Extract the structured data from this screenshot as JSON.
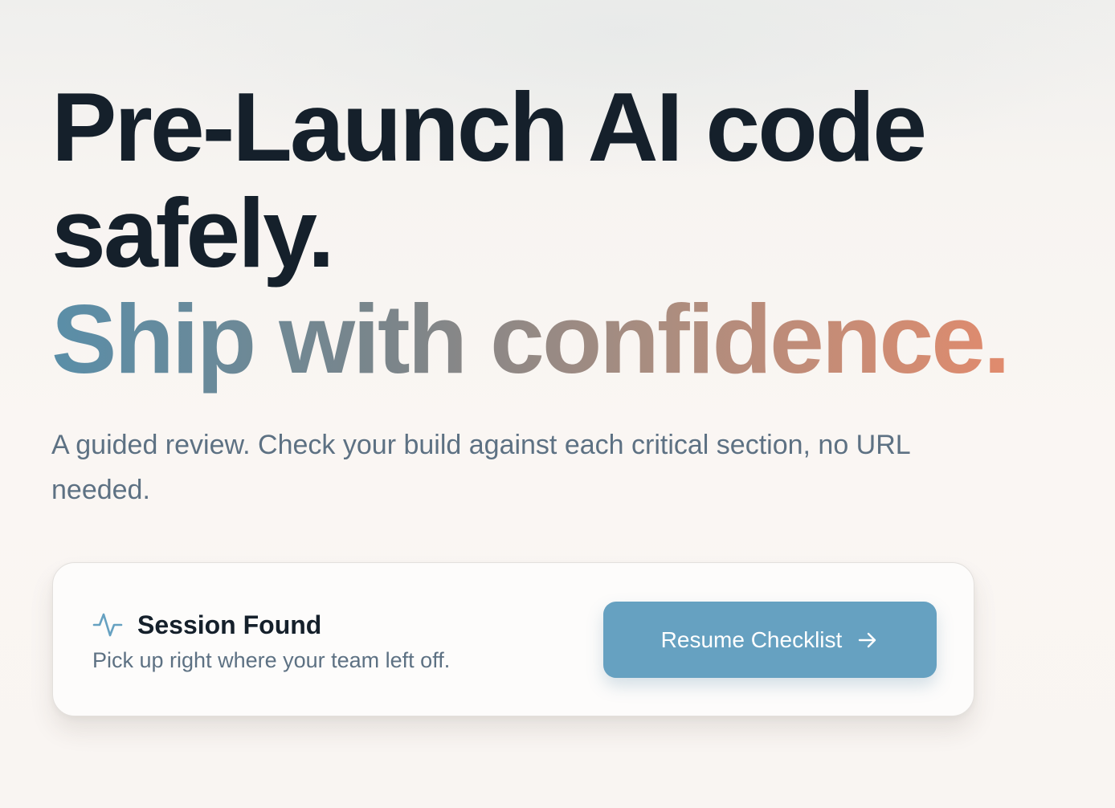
{
  "hero": {
    "headline_line1": "Pre-Launch AI code",
    "headline_line2": "safely.",
    "headline_line3": "Ship with confidence.",
    "subtitle": "A guided review. Check your build against each critical section, no URL needed."
  },
  "session": {
    "icon": "activity-pulse-icon",
    "title": "Session Found",
    "description": "Pick up right where your team left off.",
    "button_label": "Resume Checklist",
    "button_icon": "arrow-right-icon"
  },
  "colors": {
    "heading": "#15202b",
    "body_text": "#5d7183",
    "accent_blue": "#66a1c1",
    "gradient_start": "#5a8ea8",
    "gradient_end": "#e28b6d",
    "card_background": "#fdfcfb"
  }
}
